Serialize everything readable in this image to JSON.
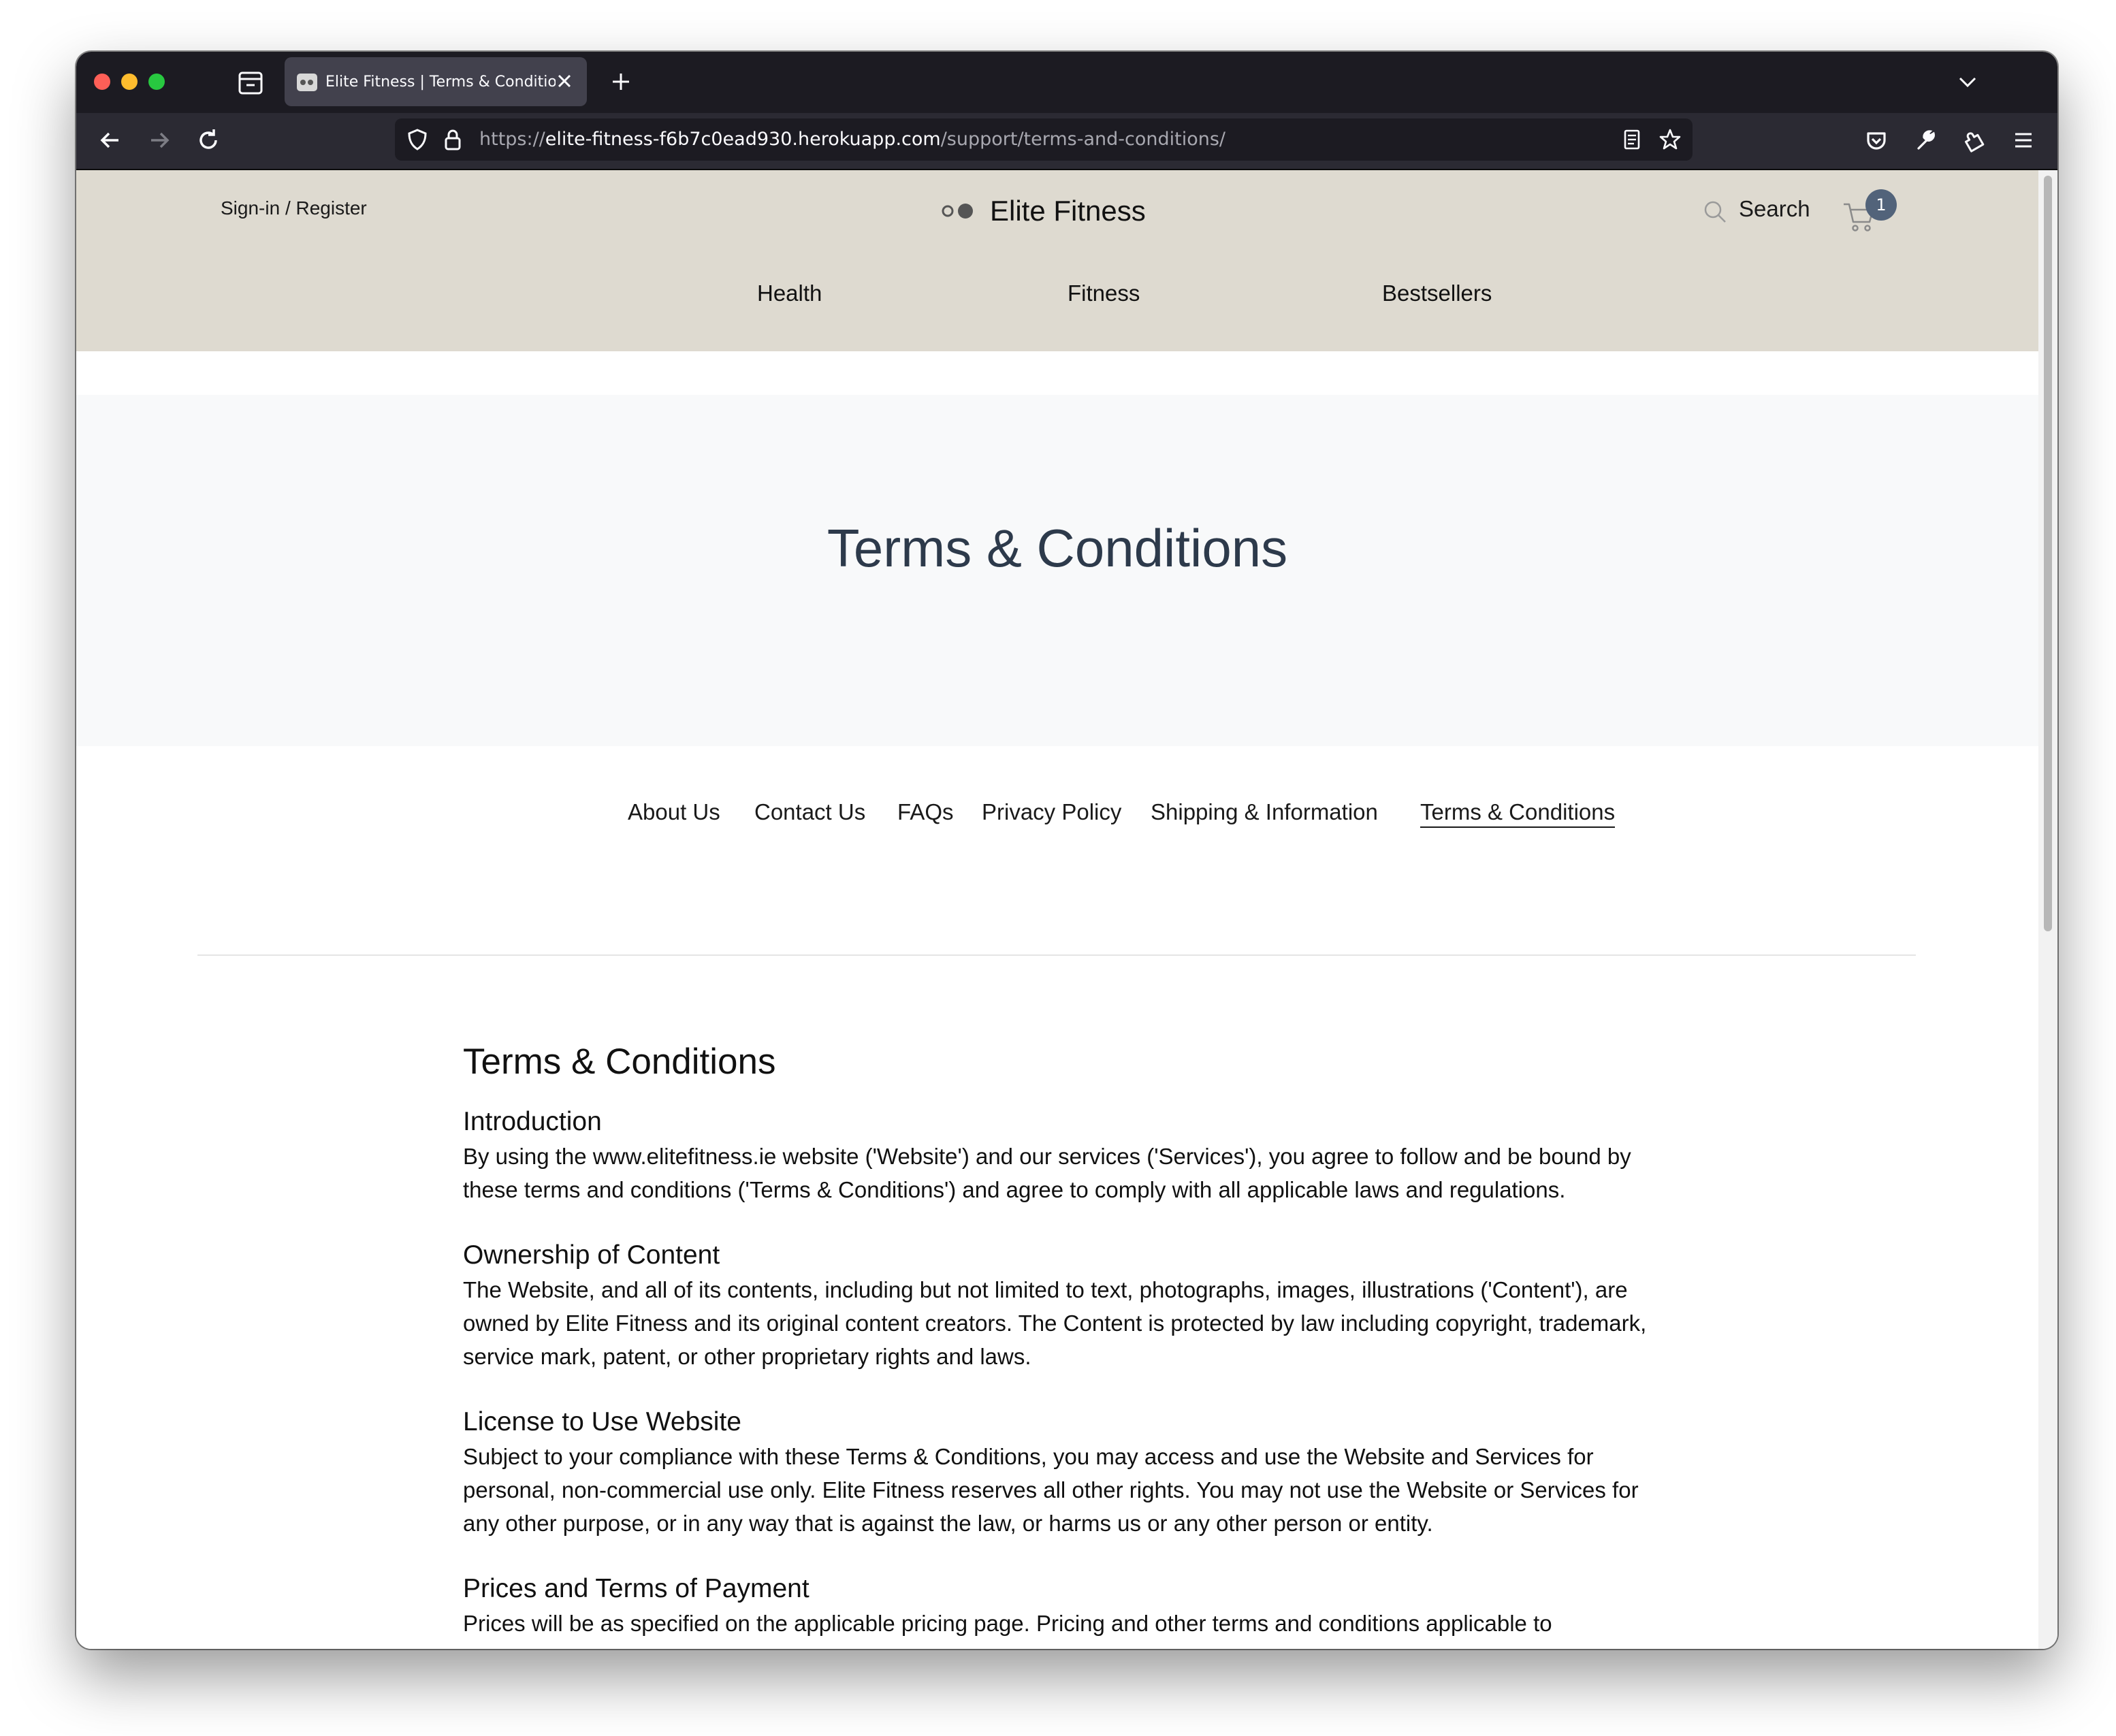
{
  "browser": {
    "tab_title": "Elite Fitness | Terms & Conditions",
    "url_scheme": "https://",
    "url_host": "elite-fitness-f6b7c0ead930.herokuapp.com",
    "url_path": "/support/terms-and-conditions/"
  },
  "header": {
    "signin_label": "Sign-in / Register",
    "brand": "Elite Fitness",
    "search_label": "Search",
    "cart_count": "1",
    "nav": [
      "Health",
      "Fitness",
      "Bestsellers"
    ]
  },
  "hero": {
    "title": "Terms & Conditions"
  },
  "subnav": {
    "items": [
      "About Us",
      "Contact Us",
      "FAQs",
      "Privacy Policy",
      "Shipping & Information",
      "Terms & Conditions"
    ],
    "active": "Terms & Conditions"
  },
  "content": {
    "title": "Terms & Conditions",
    "sections": [
      {
        "heading": "Introduction",
        "body": "By using the www.elitefitness.ie website ('Website') and our services ('Services'), you agree to follow and be bound by these terms and conditions ('Terms & Conditions') and agree to comply with all applicable laws and regulations."
      },
      {
        "heading": "Ownership of Content",
        "body": "The Website, and all of its contents, including but not limited to text, photographs, images, illustrations ('Content'), are owned by Elite Fitness and its original content creators. The Content is protected by law including copyright, trademark, service mark, patent, or other proprietary rights and laws."
      },
      {
        "heading": "License to Use Website",
        "body": "Subject to your compliance with these Terms & Conditions, you may access and use the Website and Services for personal, non-commercial use only. Elite Fitness reserves all other rights. You may not use the Website or Services for any other purpose, or in any way that is against the law, or harms us or any other person or entity."
      },
      {
        "heading": "Prices and Terms of Payment",
        "body": "Prices will be as specified on the applicable pricing page. Pricing and other terms and conditions applicable to"
      }
    ]
  }
}
